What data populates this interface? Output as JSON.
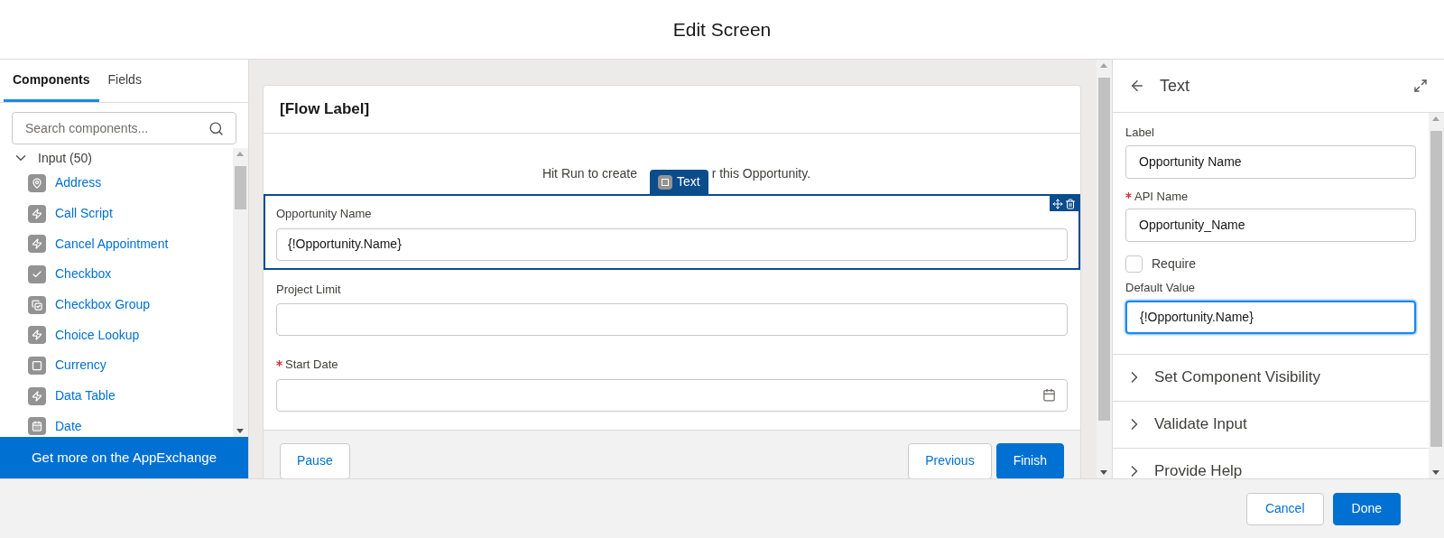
{
  "window": {
    "title": "Edit Screen"
  },
  "left_panel": {
    "tabs": [
      {
        "label": "Components",
        "selected": true
      },
      {
        "label": "Fields",
        "selected": false
      }
    ],
    "search": {
      "placeholder": "Search components..."
    },
    "group": {
      "label": "Input (50)",
      "expanded": true,
      "items": [
        {
          "label": "Address",
          "kind": "pin"
        },
        {
          "label": "Call Script",
          "kind": "bolt"
        },
        {
          "label": "Cancel Appointment",
          "kind": "bolt"
        },
        {
          "label": "Checkbox",
          "kind": "check"
        },
        {
          "label": "Checkbox Group",
          "kind": "group"
        },
        {
          "label": "Choice Lookup",
          "kind": "bolt"
        },
        {
          "label": "Currency",
          "kind": "square"
        },
        {
          "label": "Data Table",
          "kind": "bolt"
        },
        {
          "label": "Date",
          "kind": "calendar"
        }
      ]
    },
    "appexchange_button": "Get more on the AppExchange"
  },
  "canvas": {
    "card_title": "[Flow Label]",
    "intro_text_before": "Hit Run to create",
    "intro_text_after": "r this Opportunity.",
    "selected_badge": "Text",
    "fields": [
      {
        "label": "Opportunity Name",
        "required": false,
        "value": "{!Opportunity.Name}",
        "kind": "text",
        "selected": true
      },
      {
        "label": "Project Limit",
        "required": false,
        "kind": "text",
        "selected": false
      },
      {
        "label": "Start Date",
        "required": true,
        "kind": "date",
        "selected": false
      }
    ],
    "buttons_left": [
      "Pause"
    ],
    "buttons_right": [
      {
        "label": "Previous",
        "primary": false
      },
      {
        "label": "Finish",
        "primary": true
      }
    ]
  },
  "properties": {
    "title": "Text",
    "fields": [
      {
        "label": "Label",
        "required": false,
        "value": "Opportunity Name",
        "focused": false,
        "kind": "input"
      },
      {
        "label": "API Name",
        "required": true,
        "value": "Opportunity_Name",
        "focused": false,
        "kind": "input"
      },
      {
        "label": "Require",
        "checked": false,
        "kind": "checkbox"
      },
      {
        "label": "Default Value",
        "required": false,
        "value": "{!Opportunity.Name}",
        "focused": true,
        "kind": "input"
      }
    ],
    "sections": [
      {
        "label": "Set Component Visibility",
        "expanded": false
      },
      {
        "label": "Validate Input",
        "expanded": false
      },
      {
        "label": "Provide Help",
        "expanded": false
      }
    ]
  },
  "footer": {
    "buttons": [
      {
        "label": "Cancel",
        "primary": false
      },
      {
        "label": "Done",
        "primary": true
      }
    ]
  }
}
